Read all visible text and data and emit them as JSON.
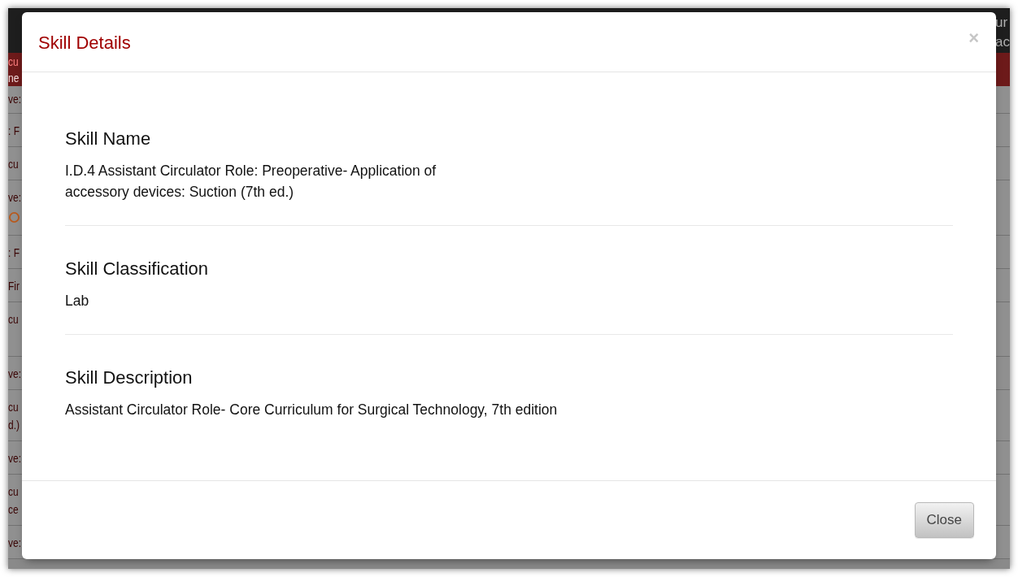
{
  "background": {
    "header_text": [
      "ur",
      "ac"
    ],
    "nav_bar_text": [
      "cu",
      "ne"
    ],
    "rows": [
      {
        "kind": "text",
        "lines": [
          "ve:"
        ]
      },
      {
        "kind": "text",
        "lines": [
          ": F"
        ]
      },
      {
        "kind": "text",
        "lines": [
          "cu"
        ]
      },
      {
        "kind": "text_icon",
        "lines": [
          "ve:"
        ]
      },
      {
        "kind": "text",
        "lines": [
          ": F"
        ]
      },
      {
        "kind": "text",
        "lines": [
          "Fir"
        ]
      },
      {
        "kind": "tall_text",
        "lines": [
          "cu"
        ]
      },
      {
        "kind": "text",
        "lines": [
          "ve:"
        ]
      },
      {
        "kind": "text",
        "lines": [
          "cu",
          "d.)"
        ]
      },
      {
        "kind": "text",
        "lines": [
          "ve:"
        ]
      },
      {
        "kind": "text",
        "lines": [
          "cu",
          "ce"
        ]
      },
      {
        "kind": "text",
        "lines": [
          "ve:"
        ]
      }
    ]
  },
  "modal": {
    "title": "Skill Details",
    "close_symbol": "×",
    "sections": [
      {
        "heading": "Skill Name",
        "value_lines": [
          "I.D.4 Assistant Circulator Role: Preoperative- Application of",
          "accessory devices: Suction (7th ed.)"
        ]
      },
      {
        "heading": "Skill Classification",
        "value_lines": [
          "Lab"
        ]
      },
      {
        "heading": "Skill Description",
        "value_lines": [
          "Assistant Circulator Role- Core Curriculum for Surgical Technology, 7th edition"
        ]
      }
    ],
    "buttons": [
      "Close"
    ]
  }
}
